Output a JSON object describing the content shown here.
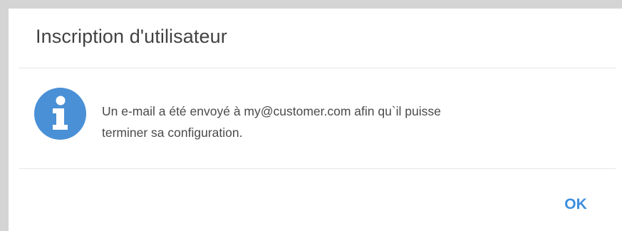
{
  "dialog": {
    "title": "Inscription d'utilisateur",
    "icon": "info-icon",
    "message_line1": "Un e-mail a été envoyé à my@customer.com afin qu`il puisse",
    "message_line2": "terminer sa configuration.",
    "ok_label": "OK"
  },
  "colors": {
    "accent": "#3d8ee0",
    "icon": "#4a90d6",
    "title": "#424242",
    "text": "#4a4a4a",
    "divider": "#e6e6e6"
  }
}
